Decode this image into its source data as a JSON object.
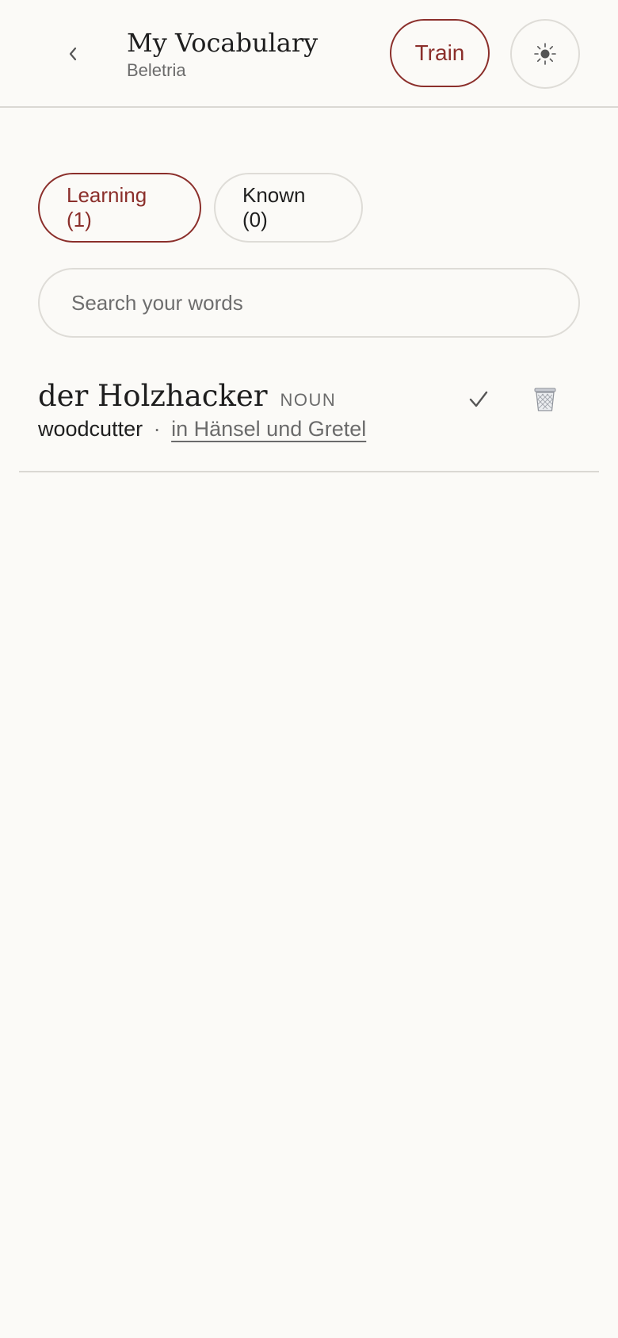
{
  "header": {
    "back_icon": "chevron-left-icon",
    "title": "My Vocabulary",
    "subtitle": "Beletria",
    "train_label": "Train",
    "theme_icon": "sun-icon"
  },
  "colors": {
    "accent": "#8b2f2b",
    "background": "#fbfaf7",
    "border": "#dedcd7",
    "muted_text": "#6b6b6b"
  },
  "tabs": [
    {
      "label": "Learning (1)",
      "active": true
    },
    {
      "label": "Known (0)",
      "active": false
    }
  ],
  "search": {
    "placeholder": "Search your words",
    "value": ""
  },
  "words": [
    {
      "headword": "der Holzhacker",
      "part_of_speech": "NOUN",
      "translation": "woodcutter",
      "separator": "·",
      "source": "in Hänsel und Gretel",
      "known_icon": "checkmark-icon",
      "delete_icon": "trash-icon"
    }
  ]
}
